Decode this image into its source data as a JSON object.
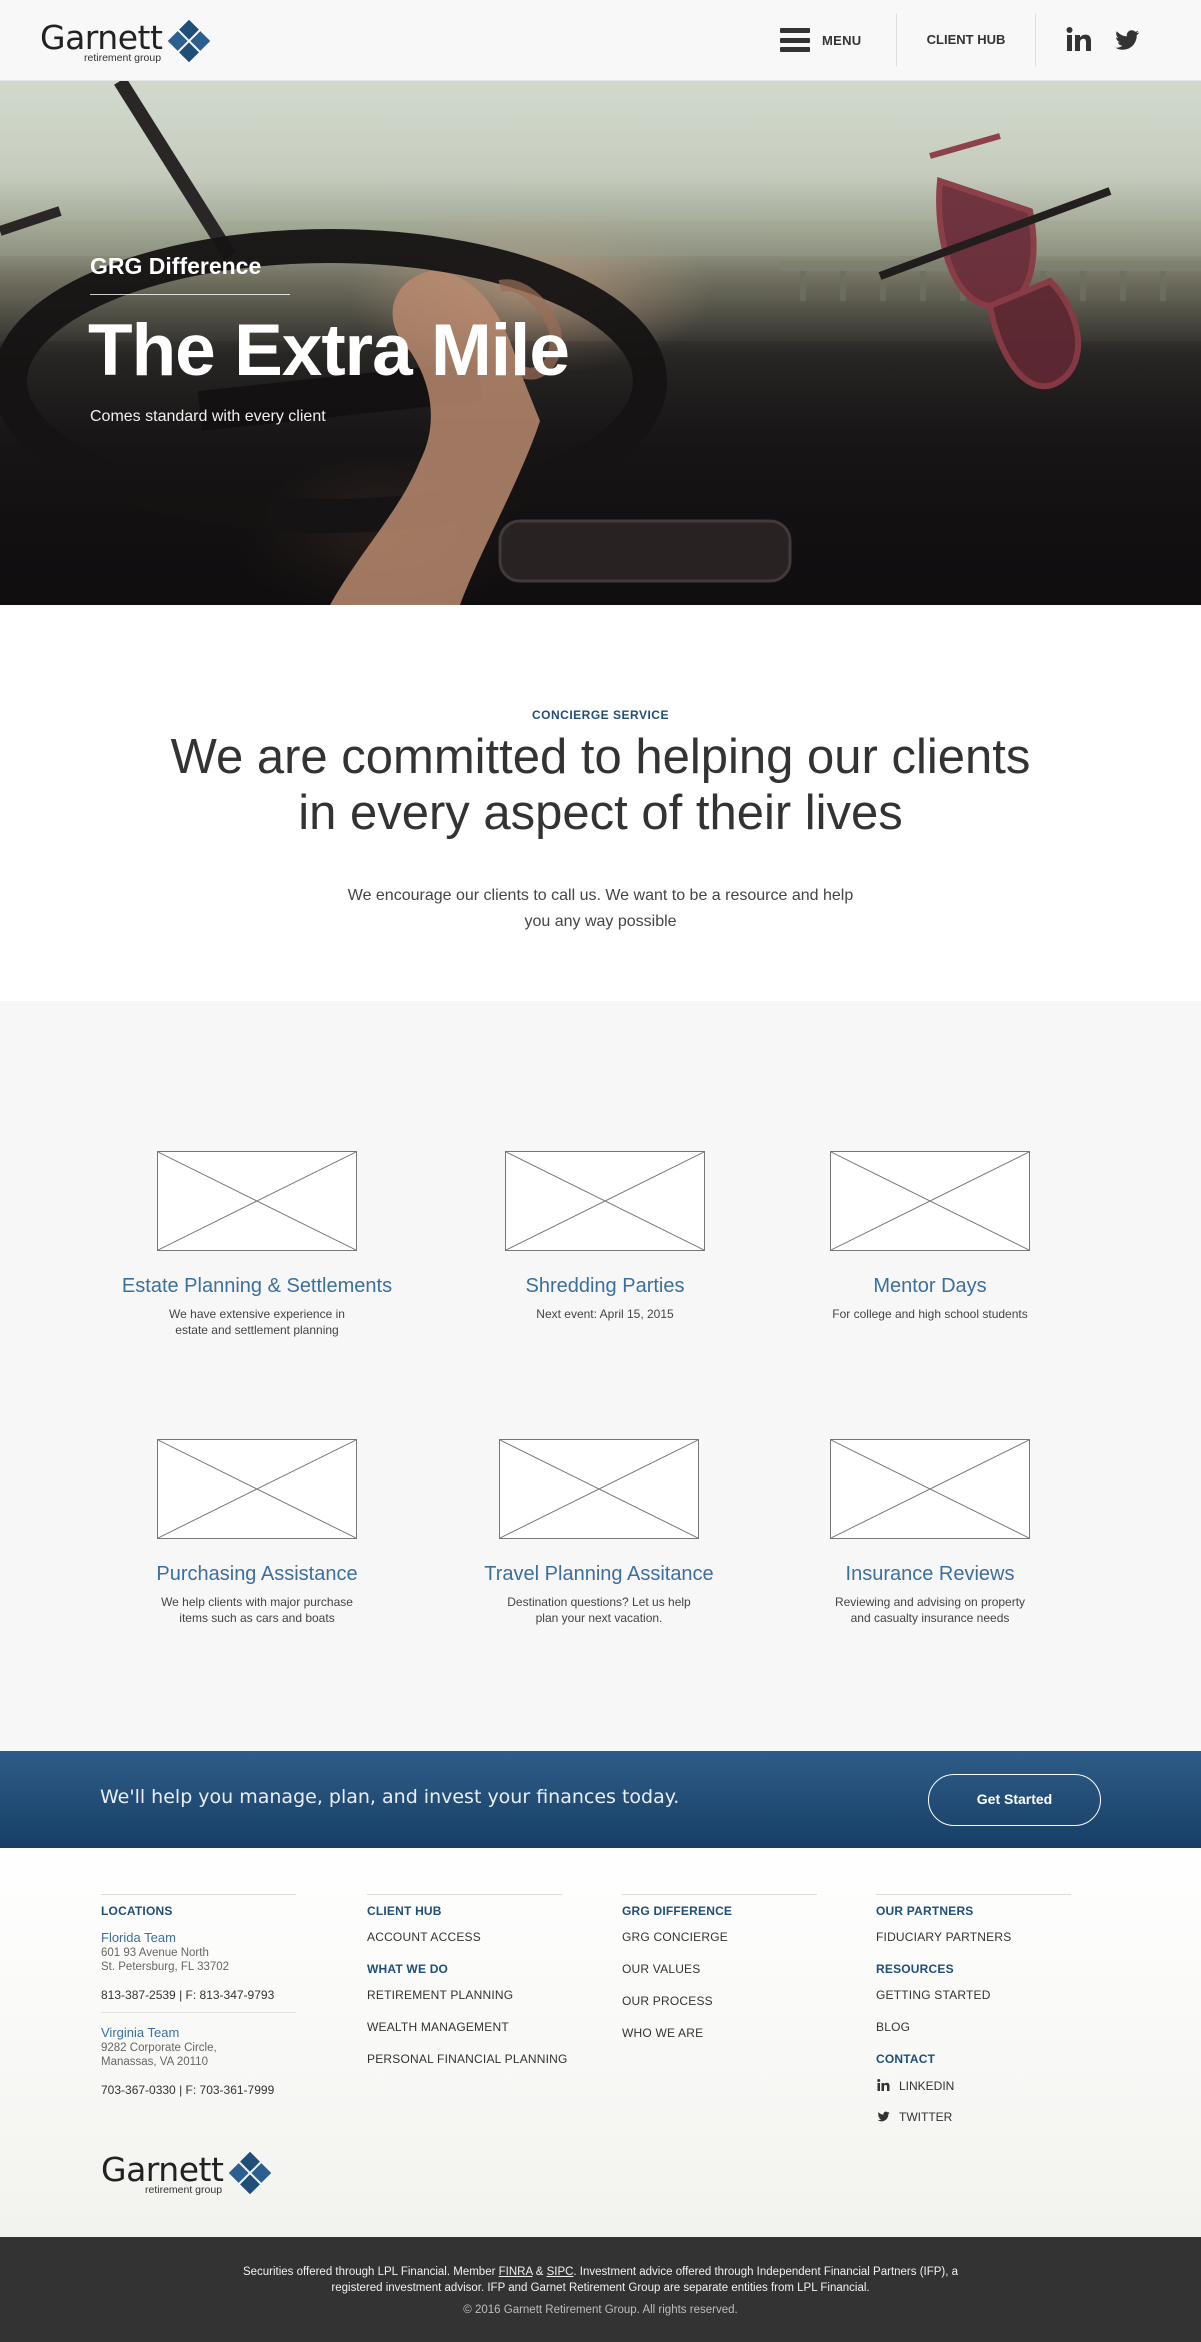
{
  "header": {
    "logo_word": "Garnett",
    "logo_sub": "retirement group",
    "menu_label": "MENU",
    "client_hub_label": "CLIENT HUB",
    "icons": [
      "menu-icon",
      "linkedin-icon",
      "twitter-icon"
    ]
  },
  "hero": {
    "kicker": "GRG Difference",
    "title": "The Extra Mile",
    "subtitle": "Comes standard with every client"
  },
  "concierge": {
    "kicker": "CONCIERGE SERVICE",
    "title_line1": "We are committed to helping our clients",
    "title_line2": "in every aspect of their lives",
    "body_line1": "We encourage our clients to call us.  We want to be a resource and help",
    "body_line2": "you any way possible"
  },
  "services": [
    {
      "title": "Estate Planning & Settlements",
      "desc_line1": "We have extensive experience in",
      "desc_line2": "estate and settlement planning"
    },
    {
      "title": "Shredding Parties",
      "desc_line1": "Next event: April 15, 2015",
      "desc_line2": ""
    },
    {
      "title": "Mentor Days",
      "desc_line1": "For college and high school students",
      "desc_line2": ""
    },
    {
      "title": "Purchasing Assistance",
      "desc_line1": "We help clients with major purchase",
      "desc_line2": "items such as cars and boats"
    },
    {
      "title": "Travel Planning Assitance",
      "desc_line1": "Destination questions? Let us help",
      "desc_line2": "plan your next vacation."
    },
    {
      "title": "Insurance Reviews",
      "desc_line1": "Reviewing and advising on property",
      "desc_line2": "and casualty insurance needs"
    }
  ],
  "cta": {
    "text": "We'll help you manage, plan, and invest your finances today.",
    "button": "Get Started"
  },
  "footer": {
    "locations": {
      "heading": "LOCATIONS",
      "florida": {
        "name": "Florida Team",
        "addr1": "601 93 Avenue North",
        "addr2": "St. Petersburg, FL 33702",
        "phone": "813-387-2539 | F: 813-347-9793"
      },
      "virginia": {
        "name": "Virginia Team",
        "addr1": "9282 Corporate Circle,",
        "addr2": "Manassas, VA 20110",
        "phone": "703-367-0330 | F: 703-361-7999"
      }
    },
    "col2": {
      "heading1": "CLIENT HUB",
      "links1": [
        "ACCOUNT ACCESS"
      ],
      "heading2": "WHAT WE DO",
      "links2": [
        "RETIREMENT PLANNING",
        "WEALTH MANAGEMENT",
        "PERSONAL FINANCIAL PLANNING"
      ]
    },
    "col3": {
      "heading": "GRG DIFFERENCE",
      "links": [
        "GRG CONCIERGE",
        "OUR VALUES",
        "OUR PROCESS",
        "WHO WE ARE"
      ]
    },
    "col4": {
      "heading1": "OUR PARTNERS",
      "links1": [
        "FIDUCIARY PARTNERS"
      ],
      "heading2": "RESOURCES",
      "links2": [
        "GETTING STARTED",
        "BLOG"
      ],
      "heading3": "CONTACT",
      "social": [
        "LINKEDIN",
        "TWITTER"
      ]
    },
    "logo_word": "Garnett",
    "logo_sub": "retirement group"
  },
  "legal": {
    "l1_a": "Securities offered through LPL Financial. Member ",
    "finra": "FINRA",
    "amp": " & ",
    "sipc": "SIPC",
    "l1_b": ". Investment advice offered through Independent Financial Partners (IFP), a",
    "l2": "registered investment advisor.  IFP and Garnet Retirement Group are separate entities from LPL Financial.",
    "copyright": "© 2016 Garnett Retirement Group. All rights reserved."
  },
  "colors": {
    "brand_blue": "#1f4e79",
    "link_blue": "#3a6f9f",
    "cta_top": "#2e5c87",
    "cta_bottom": "#173f66",
    "legal_bg": "#333333"
  }
}
